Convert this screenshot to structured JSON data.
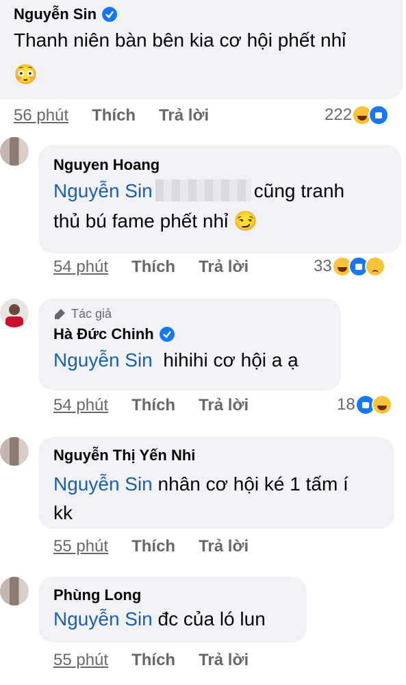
{
  "comments": [
    {
      "author": "Nguyễn Sin",
      "verified": true,
      "text_line1": "Thanh niên bàn bên kia cơ hội phết nhỉ",
      "text_line2": "😳",
      "time": "56 phút",
      "like": "Thích",
      "reply": "Trả lời",
      "react_count": "222",
      "reactions": [
        "haha-icon",
        "like-icon"
      ]
    },
    {
      "author": "Nguyen Hoang",
      "mention": "Nguyễn Sin",
      "text_after_blur": "cũng tranh",
      "text_line2": "thủ bú fame phết nhỉ 😏",
      "time": "54 phút",
      "like": "Thích",
      "reply": "Trả lời",
      "react_count": "33",
      "reactions": [
        "haha-icon",
        "like-icon",
        "sad-icon"
      ]
    },
    {
      "badge": "Tác giả",
      "author": "Hà Đức Chinh",
      "verified": true,
      "mention": "Nguyễn Sin",
      "text": "hihihi cơ hội a ạ",
      "time": "54 phút",
      "like": "Thích",
      "reply": "Trả lời",
      "react_count": "18",
      "reactions": [
        "like-icon",
        "haha-icon"
      ]
    },
    {
      "author": "Nguyễn Thị Yến Nhi",
      "mention": "Nguyễn Sin",
      "text": "nhân cơ hội ké 1 tấm í",
      "text_line2": "kk",
      "time": "55 phút",
      "like": "Thích",
      "reply": "Trả lời"
    },
    {
      "author": "Phùng Long",
      "mention": "Nguyễn Sin",
      "text": "đc của ló lun",
      "time": "55 phút",
      "like": "Thích",
      "reply": "Trả lời"
    }
  ],
  "colors": {
    "mention": "#1d5ea8",
    "bubble": "#f0f2f5",
    "meta": "#65676b",
    "verified": "#1877f2"
  }
}
